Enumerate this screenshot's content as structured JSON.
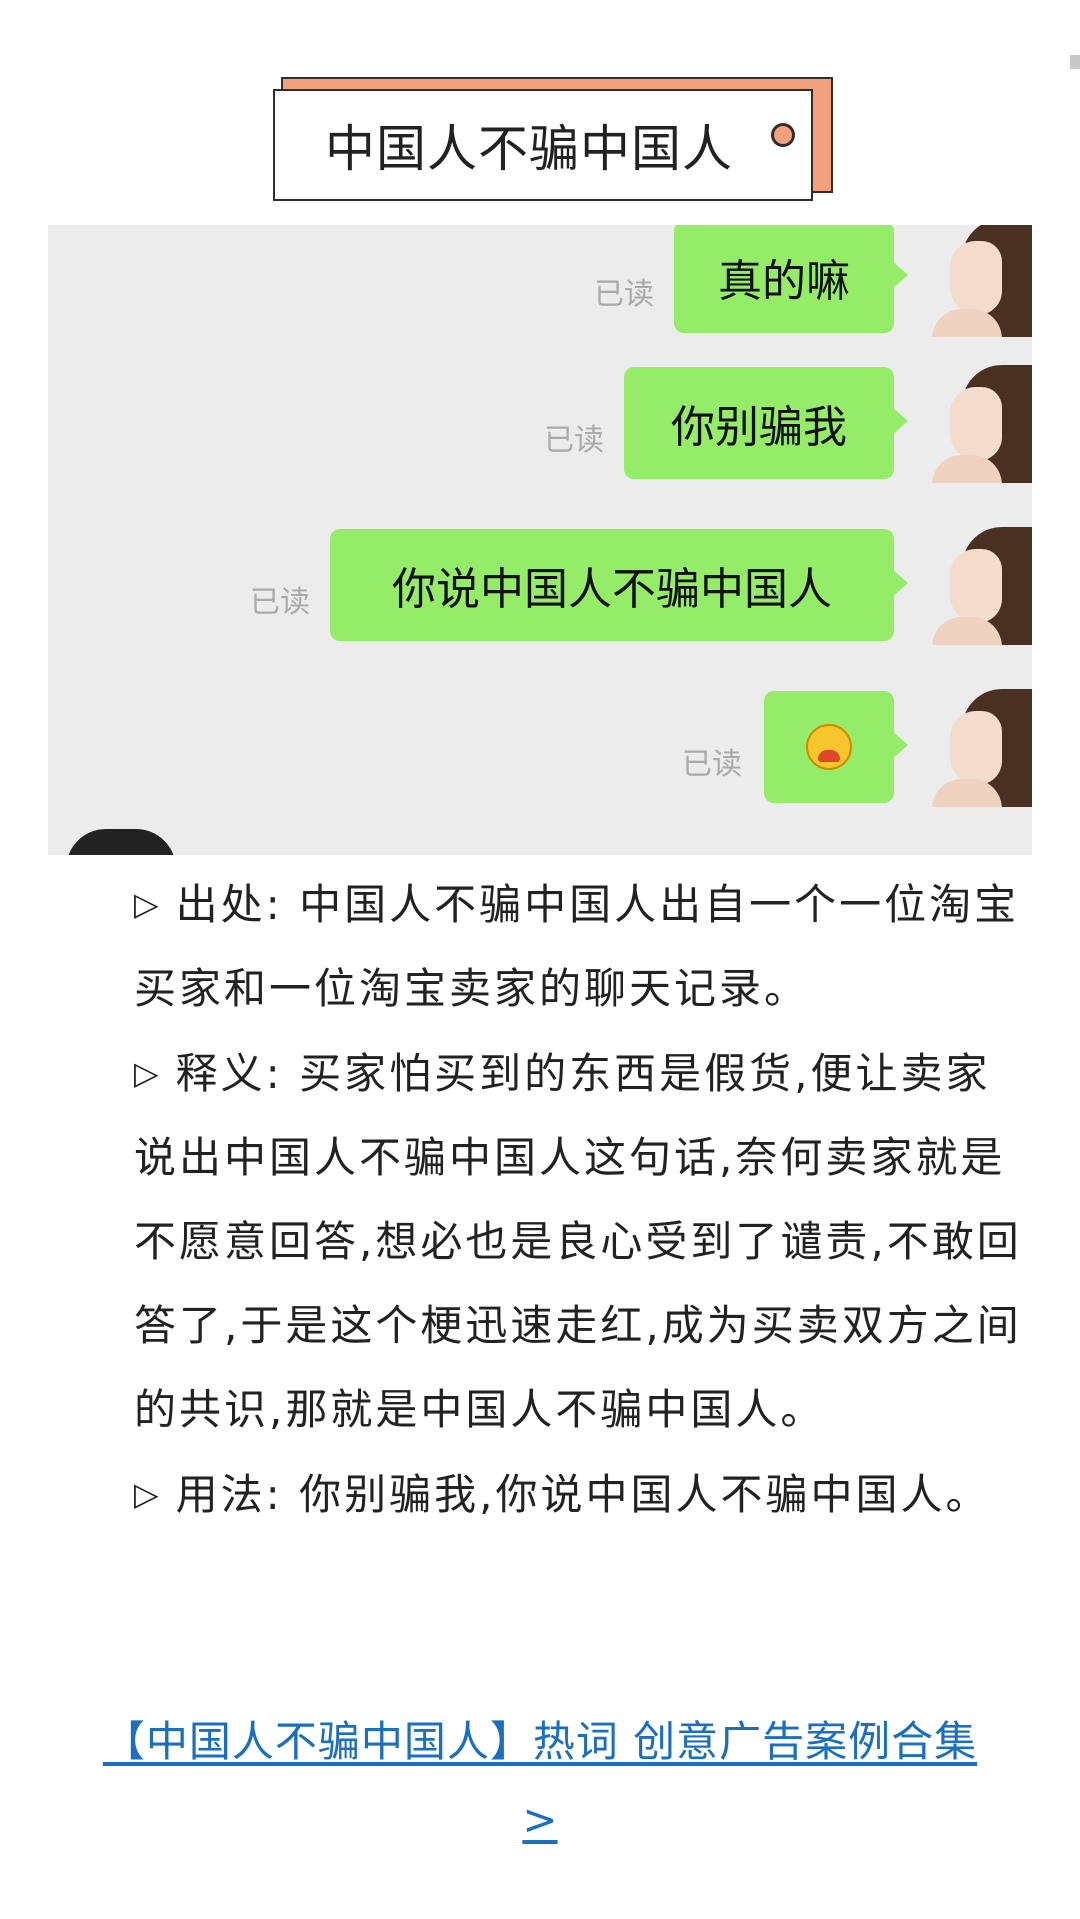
{
  "title": "中国人不骗中国人",
  "chat": {
    "messages": [
      {
        "text": "真的嘛",
        "status": "已读"
      },
      {
        "text": "你别骗我",
        "status": "已读"
      },
      {
        "text": "你说中国人不骗中国人",
        "status": "已读"
      },
      {
        "emoji": "crying-duck-emoji",
        "status": "已读"
      }
    ]
  },
  "content": {
    "origin_label": "出处:",
    "origin_text": "中国人不骗中国人出自一个一位淘宝买家和一位淘宝卖家的聊天记录。",
    "meaning_label": "释义:",
    "meaning_text": "买家怕买到的东西是假货,便让卖家说出中国人不骗中国人这句话,奈何卖家就是不愿意回答,想必也是良心受到了谴责,不敢回答了,于是这个梗迅速走红,成为买卖双方之间的共识,那就是中国人不骗中国人。",
    "usage_label": "用法:",
    "usage_text": "你别骗我,你说中国人不骗中国人。"
  },
  "link": {
    "text": "【中国人不骗中国人】热词 创意广告案例合集",
    "arrow": ">"
  },
  "colors": {
    "accent": "#f3a07d",
    "bubble": "#95ec69",
    "link": "#1a6fbf"
  }
}
